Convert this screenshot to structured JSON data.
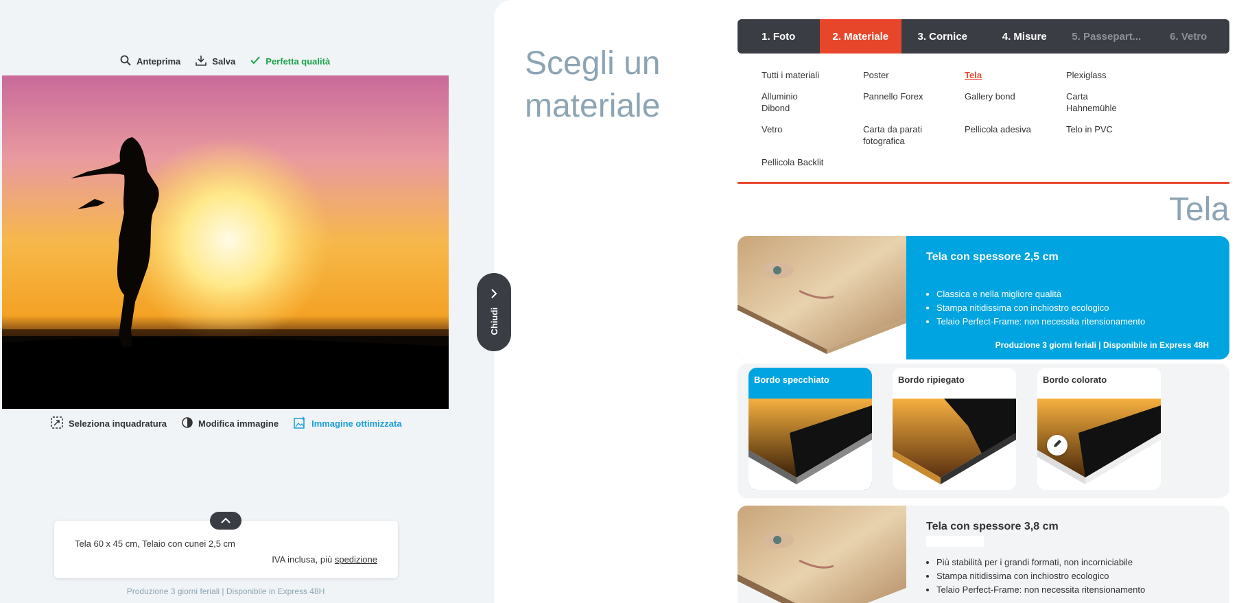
{
  "toolbar_top": {
    "preview": "Anteprima",
    "save": "Salva",
    "quality": "Perfetta qualità"
  },
  "toolbar_bottom": {
    "crop": "Seleziona inquadratura",
    "edit": "Modifica immagine",
    "optimized": "Immagine ottimizzata"
  },
  "summary": {
    "description": "Tela 60 x 45 cm, Telaio con cunei 2,5 cm",
    "vat_prefix": "IVA inclusa, più ",
    "shipping_link": "spedizione"
  },
  "production_left": "Produzione 3 giorni feriali | Disponibile in Express 48H",
  "close_label": "Chiudi",
  "heading": "Scegli un materiale",
  "steps": [
    {
      "label": "1. Foto"
    },
    {
      "label": "2. Materiale"
    },
    {
      "label": "3. Cornice"
    },
    {
      "label": "4. Misure"
    },
    {
      "label": "5. Passepart..."
    },
    {
      "label": "6. Vetro"
    }
  ],
  "materials": [
    "Tutti i materiali",
    "Poster",
    "Tela",
    "Plexiglass",
    "Alluminio Dibond",
    "Pannello Forex",
    "Gallery bond",
    "Carta Hahnemühle",
    "Vetro",
    "Carta da parati fotografica",
    "Pellicola adesiva",
    "Telo in PVC",
    "Pellicola Backlit"
  ],
  "selected_material": "Tela",
  "category_title": "Tela",
  "card1": {
    "title": "Tela con spessore 2,5 cm",
    "bullets": [
      "Classica e nella migliore qualità",
      "Stampa nitidissima con inchiostro ecologico",
      "Telaio Perfect-Frame: non necessita ritensionamento"
    ],
    "production": "Produzione 3 giorni feriali | Disponibile in Express 48H"
  },
  "edges": [
    {
      "label": "Bordo specchiato"
    },
    {
      "label": "Bordo ripiegato"
    },
    {
      "label": "Bordo colorato"
    }
  ],
  "card2": {
    "title": "Tela con spessore 3,8 cm",
    "bullets": [
      "Più stabilità per i grandi formati, non incorniciabile",
      "Stampa nitidissima con inchiostro ecologico",
      "Telaio Perfect-Frame: non necessita ritensionamento"
    ]
  },
  "colors": {
    "accent": "#e8462a",
    "blue": "#00a4e0",
    "dark": "#3a3d44",
    "muted": "#8ca4b4",
    "success": "#1aa34a"
  }
}
